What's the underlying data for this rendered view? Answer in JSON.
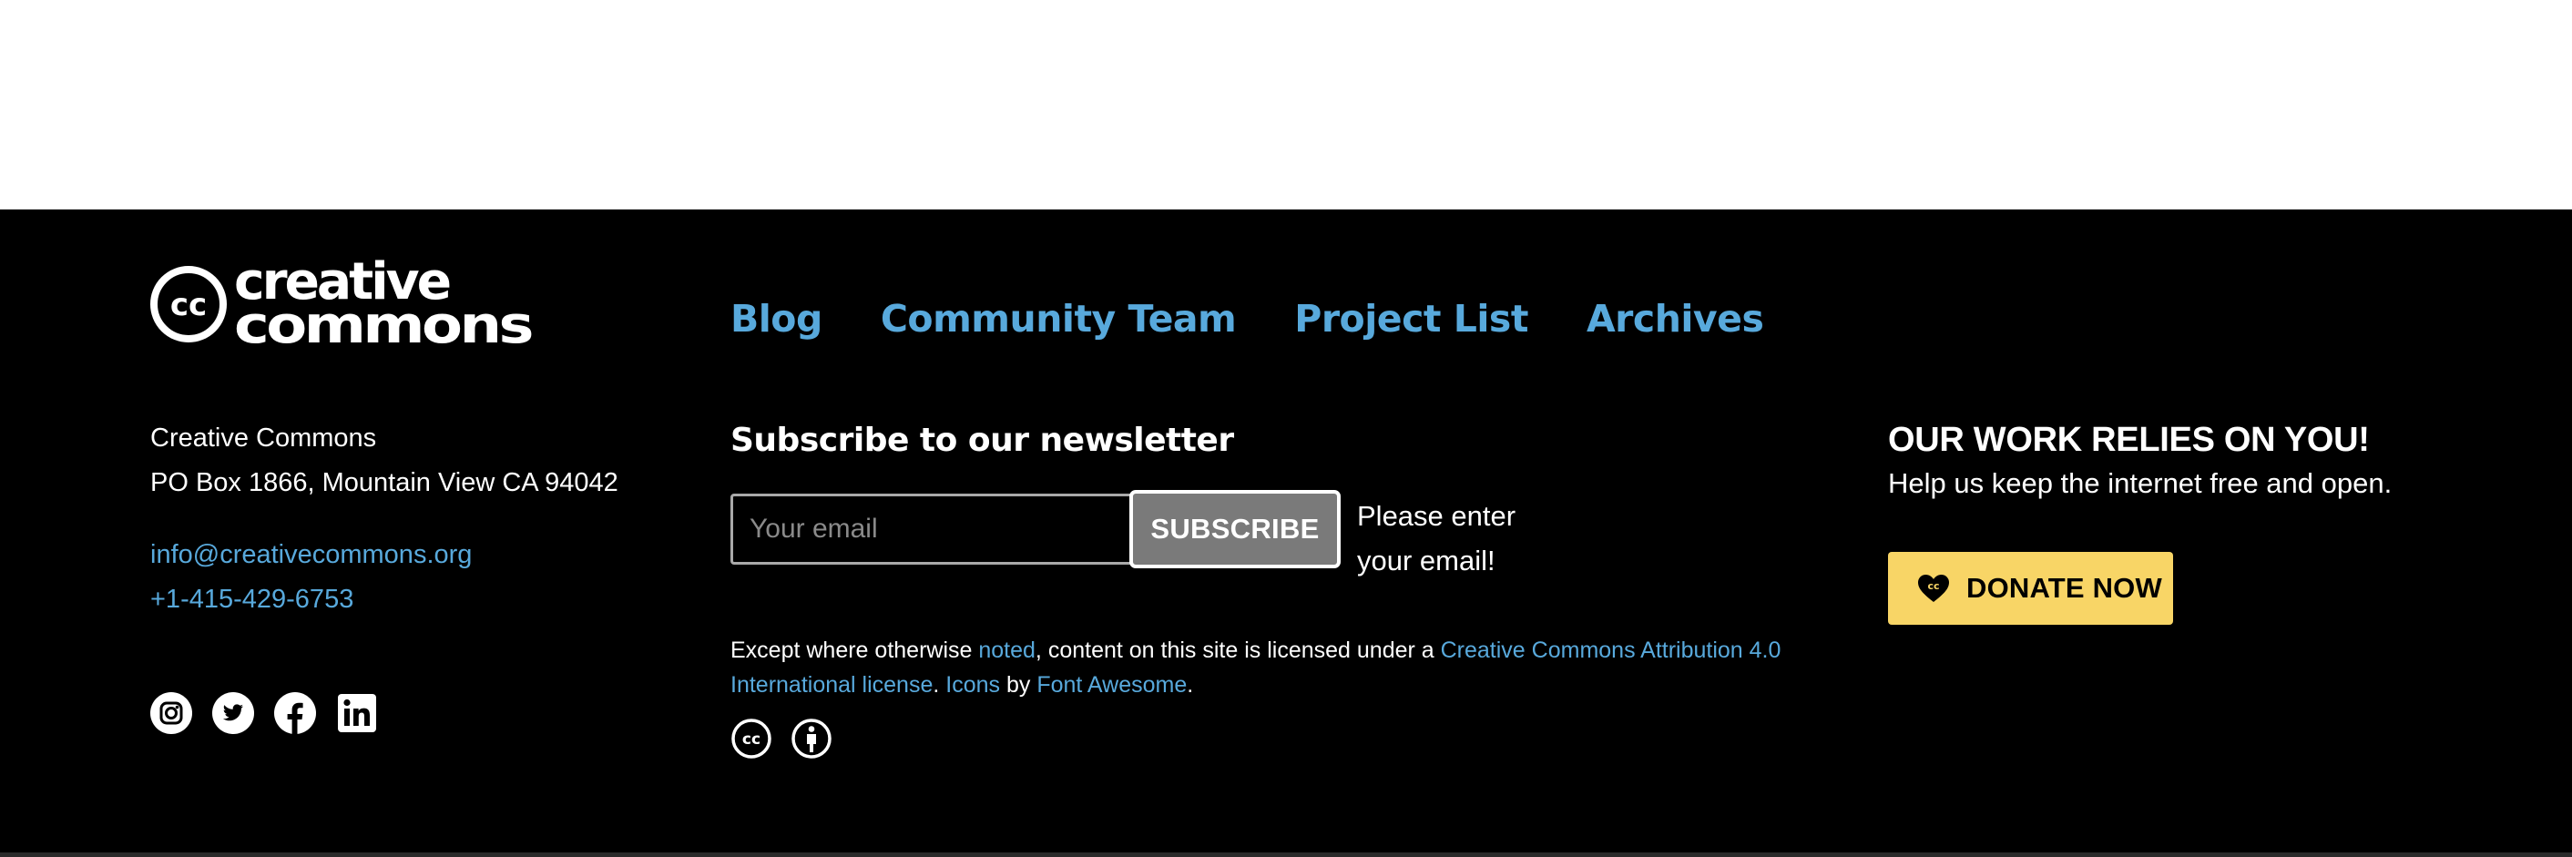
{
  "logo": {
    "line1": "creative",
    "line2": "commons",
    "badge": "cc"
  },
  "nav": [
    "Blog",
    "Community Team",
    "Project List",
    "Archives"
  ],
  "address": {
    "org": "Creative Commons",
    "street": "PO Box 1866, Mountain View CA 94042"
  },
  "contact": {
    "email": "info@creativecommons.org",
    "phone": "+1-415-429-6753"
  },
  "social_icons": [
    "instagram-icon",
    "twitter-icon",
    "facebook-icon",
    "linkedin-icon"
  ],
  "newsletter": {
    "title": "Subscribe to our newsletter",
    "placeholder": "Your email",
    "value": "",
    "button": "SUBSCRIBE",
    "message": "Please enter your email!"
  },
  "license": {
    "text_1": "Except where otherwise ",
    "link_noted": "noted",
    "text_2": ", content on this site is licensed under a ",
    "link_license": "Creative Commons Attribution 4.0 International license",
    "text_3": ". ",
    "link_icons": "Icons",
    "text_4": " by ",
    "link_fontawesome": "Font Awesome",
    "text_5": ".",
    "icons": [
      "cc-icon",
      "attribution-icon"
    ]
  },
  "donate": {
    "title": "OUR WORK RELIES ON YOU!",
    "subtitle": "Help us keep the internet free and open.",
    "button": "DONATE NOW",
    "button_color": "#f8d566"
  },
  "colors": {
    "link": "#58a9dc",
    "background": "#000000",
    "text": "#ffffff"
  }
}
